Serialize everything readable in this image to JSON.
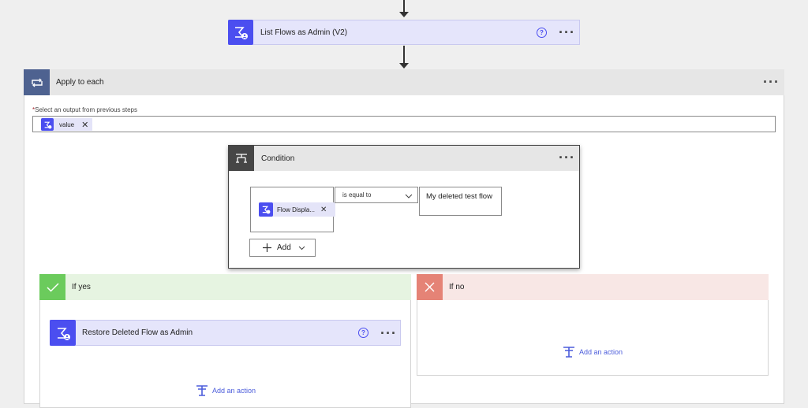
{
  "list_flows": {
    "title": "List Flows as Admin (V2)"
  },
  "apply_each": {
    "title": "Apply to each",
    "select_label": "Select an output from previous steps",
    "token": "value"
  },
  "condition": {
    "title": "Condition",
    "left_token": "Flow Displa...",
    "operator": "is equal to",
    "value": "My deleted test flow",
    "add_label": "Add"
  },
  "if_yes": {
    "title": "If yes",
    "action_title": "Restore Deleted Flow as Admin",
    "add_action": "Add an action"
  },
  "if_no": {
    "title": "If no",
    "add_action": "Add an action"
  },
  "colors": {
    "action_header": "#e5e5fb",
    "flow_icon": "#4b4ef0",
    "apply_icon": "#4e6290",
    "condition_icon": "#464646",
    "yes_header": "#e6f4e1",
    "yes_icon": "#6bcb5c",
    "no_header": "#f8e7e5",
    "no_icon": "#e58376",
    "link": "#4b5cdb"
  }
}
